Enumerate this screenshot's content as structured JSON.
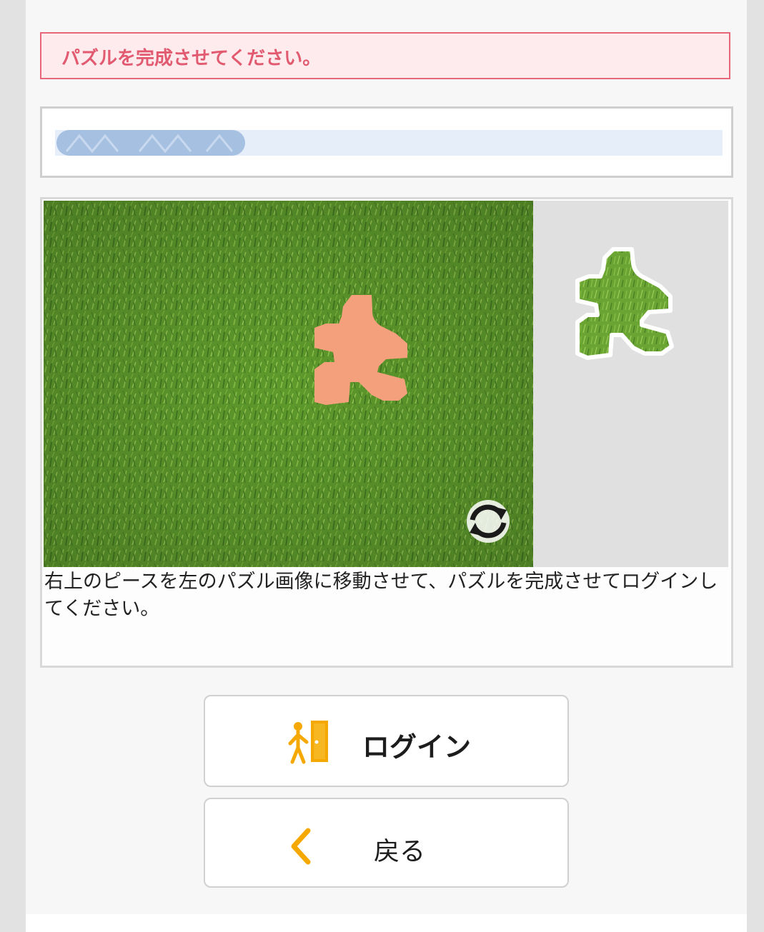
{
  "error": {
    "message": "パズルを完成させてください。"
  },
  "user_field": {
    "value": "████████████"
  },
  "puzzle": {
    "instruction": "右上のピースを左のパズル画像に移動させて、パズルを完成させてログインしてください。",
    "target_color": "#f4a07c",
    "refresh_icon": "refresh-icon",
    "piece_icon": "puzzle-piece-icon"
  },
  "buttons": {
    "login_label": "ログイン",
    "login_icon": "door-exit-icon",
    "back_label": "戻る",
    "back_icon": "chevron-left-icon"
  },
  "colors": {
    "error_border": "#e8667a",
    "error_text": "#e25a70",
    "accent_icon": "#f5a800"
  }
}
